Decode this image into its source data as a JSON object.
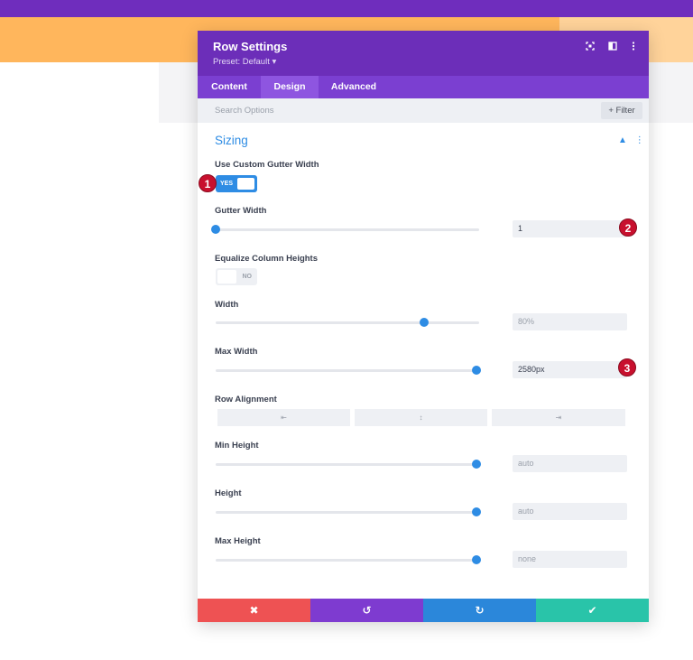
{
  "header": {
    "title": "Row Settings",
    "preset": "Preset: Default ▾",
    "icons": [
      "expand-icon",
      "split-view-icon",
      "more-icon"
    ]
  },
  "tabs": [
    {
      "label": "Content"
    },
    {
      "label": "Design",
      "active": true
    },
    {
      "label": "Advanced"
    }
  ],
  "search": {
    "placeholder": "Search Options",
    "filter_label": "+ Filter"
  },
  "section": {
    "title": "Sizing"
  },
  "fields": {
    "custom_gutter": {
      "label": "Use Custom Gutter Width",
      "toggle": "YES"
    },
    "gutter_width": {
      "label": "Gutter Width",
      "value": "1",
      "level": 0
    },
    "equalize": {
      "label": "Equalize Column Heights",
      "toggle": "NO"
    },
    "width": {
      "label": "Width",
      "value": "80%",
      "level": 0.79
    },
    "max_width": {
      "label": "Max Width",
      "value": "2580px",
      "level": 0.99
    },
    "row_alignment": {
      "label": "Row Alignment",
      "options": [
        "⇤",
        "↕",
        "⇥"
      ]
    },
    "min_height": {
      "label": "Min Height",
      "value": "auto",
      "level": 0.99
    },
    "height": {
      "label": "Height",
      "value": "auto",
      "level": 0.99
    },
    "max_height": {
      "label": "Max Height",
      "value": "none",
      "level": 0.99
    }
  },
  "badges": [
    "1",
    "2",
    "3"
  ],
  "footer": {
    "cancel": "✖",
    "undo": "↺",
    "redo": "↻",
    "save": "✔"
  },
  "colors": {
    "purple_header": "#6c2eb9",
    "accent_blue": "#2e8ce4",
    "cancel_red": "#ee5253",
    "undo_purple": "#7e3bd0",
    "redo_blue": "#2b87da",
    "save_green": "#29c4a9",
    "badge_red": "#c8102e"
  }
}
